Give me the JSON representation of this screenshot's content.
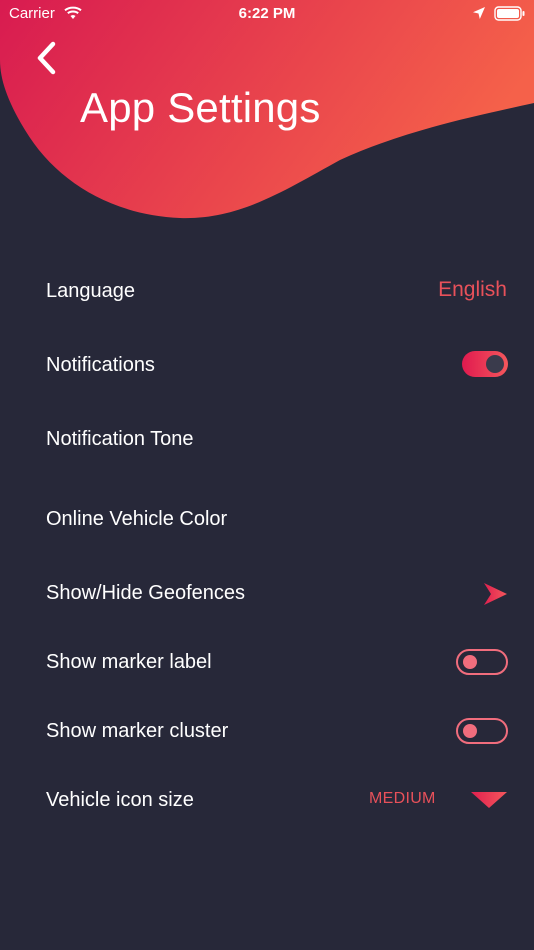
{
  "status_bar": {
    "carrier": "Carrier",
    "time": "6:22 PM",
    "icons": [
      "wifi-icon",
      "location-arrow-icon",
      "battery-icon"
    ]
  },
  "header": {
    "title": "App Settings",
    "back_icon": "chevron-left-icon",
    "gradient_colors": [
      "#d81b50",
      "#f5614a"
    ]
  },
  "colors": {
    "background": "#272839",
    "accent": "#e8515a"
  },
  "settings": {
    "language": {
      "label": "Language",
      "value": "English"
    },
    "notifications": {
      "label": "Notifications",
      "enabled": true
    },
    "notification_tone": {
      "label": "Notification Tone"
    },
    "online_vehicle_color": {
      "label": "Online Vehicle Color"
    },
    "geofences": {
      "label": "Show/Hide Geofences",
      "icon": "chevron-right-icon"
    },
    "marker_label": {
      "label": "Show marker label",
      "enabled": false
    },
    "marker_cluster": {
      "label": "Show marker cluster",
      "enabled": false
    },
    "vehicle_icon_size": {
      "label": "Vehicle icon size",
      "value": "MEDIUM",
      "icon": "caret-down-icon"
    }
  }
}
